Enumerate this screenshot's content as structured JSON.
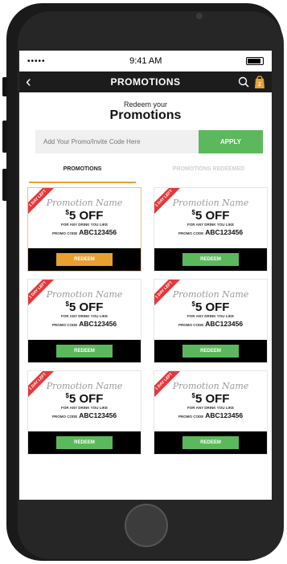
{
  "status": {
    "signal": "•••••",
    "time": "9:41 AM"
  },
  "nav": {
    "title": "PROMOTIONS",
    "cart_count": "2"
  },
  "header": {
    "subtitle": "Redeem your",
    "title": "Promotions"
  },
  "promo": {
    "placeholder": "Add Your Promo/Invite Code Here",
    "apply_label": "APPLY"
  },
  "tabs": [
    {
      "label": "PROMOTIONS",
      "active": true
    },
    {
      "label": "PROMOTIONS REDEEMED",
      "active": false
    }
  ],
  "cards": [
    {
      "badge": "1 DAY LEFT",
      "name": "Promotion Name",
      "currency": "$",
      "amount": "5 OFF",
      "desc": "FOR ANY DRINK YOU LIKE",
      "code_label": "PROMO CODE",
      "code": "ABC123456",
      "button": "REDEEM"
    },
    {
      "badge": "1 DAY LEFT",
      "name": "Promotion Name",
      "currency": "$",
      "amount": "5 OFF",
      "desc": "FOR ANY DRINK YOU LIKE",
      "code_label": "PROMO CODE",
      "code": "ABC123456",
      "button": "REDEEM"
    },
    {
      "badge": "1 DAY LEFT",
      "name": "Promotion Name",
      "currency": "$",
      "amount": "5 OFF",
      "desc": "FOR ANY DRINK YOU LIKE",
      "code_label": "PROMO CODE",
      "code": "ABC123456",
      "button": "REDEEM"
    },
    {
      "badge": "1 DAY LEFT",
      "name": "Promotion Name",
      "currency": "$",
      "amount": "5 OFF",
      "desc": "FOR ANY DRINK YOU LIKE",
      "code_label": "PROMO CODE",
      "code": "ABC123456",
      "button": "REDEEM"
    },
    {
      "badge": "1 DAY LEFT",
      "name": "Promotion Name",
      "currency": "$",
      "amount": "5 OFF",
      "desc": "FOR ANY DRINK YOU LIKE",
      "code_label": "PROMO CODE",
      "code": "ABC123456",
      "button": "REDEEM"
    },
    {
      "badge": "1 DAY LEFT",
      "name": "Promotion Name",
      "currency": "$",
      "amount": "5 OFF",
      "desc": "FOR ANY DRINK YOU LIKE",
      "code_label": "PROMO CODE",
      "code": "ABC123456",
      "button": "REDEEM"
    }
  ],
  "colors": {
    "accent": "#e8a030",
    "apply_green": "#5cb85c",
    "badge_red": "#e5383b",
    "navbar": "#1c1c1c"
  }
}
